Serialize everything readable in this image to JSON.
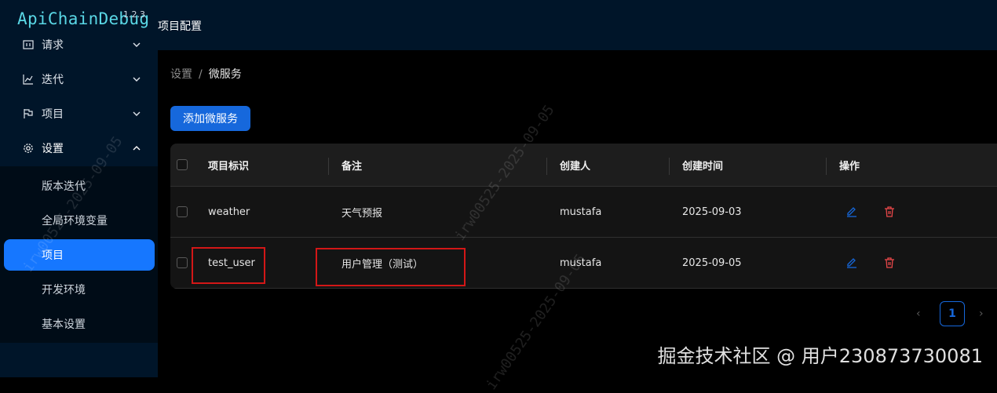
{
  "app": {
    "logo": "ApiChainDebug",
    "logo_sup": "1.2.3"
  },
  "header": {
    "title": "项目配置"
  },
  "sidebar": {
    "items": [
      {
        "label": "请求",
        "icon": "request-icon",
        "expanded": false
      },
      {
        "label": "迭代",
        "icon": "iteration-chart-icon",
        "expanded": false
      },
      {
        "label": "项目",
        "icon": "project-flag-icon",
        "expanded": false
      },
      {
        "label": "设置",
        "icon": "gear-icon",
        "expanded": true
      }
    ],
    "settings_sub": [
      {
        "label": "版本迭代"
      },
      {
        "label": "全局环境变量"
      },
      {
        "label": "项目",
        "active": true
      },
      {
        "label": "开发环境"
      },
      {
        "label": "基本设置"
      }
    ]
  },
  "breadcrumb": {
    "root": "设置",
    "sep": "/",
    "current": "微服务"
  },
  "toolbar": {
    "add_label": "添加微服务"
  },
  "table": {
    "columns": [
      "项目标识",
      "备注",
      "创建人",
      "创建时间",
      "操作"
    ],
    "rows": [
      {
        "id": "weather",
        "note": "天气预报",
        "creator": "mustafa",
        "created": "2025-09-03"
      },
      {
        "id": "test_user",
        "note": "用户管理（测试）",
        "creator": "mustafa",
        "created": "2025-09-05"
      }
    ]
  },
  "pagination": {
    "current": "1",
    "prev": "‹",
    "next": "›"
  },
  "footer_watermark": "掘金技术社区 @ 用户230873730081",
  "diag_watermark": "irw00525-2025-09-05",
  "colors": {
    "primary": "#1668dc",
    "highlight": "#d31717",
    "delete": "#e84749",
    "sidebar": "#001529"
  }
}
